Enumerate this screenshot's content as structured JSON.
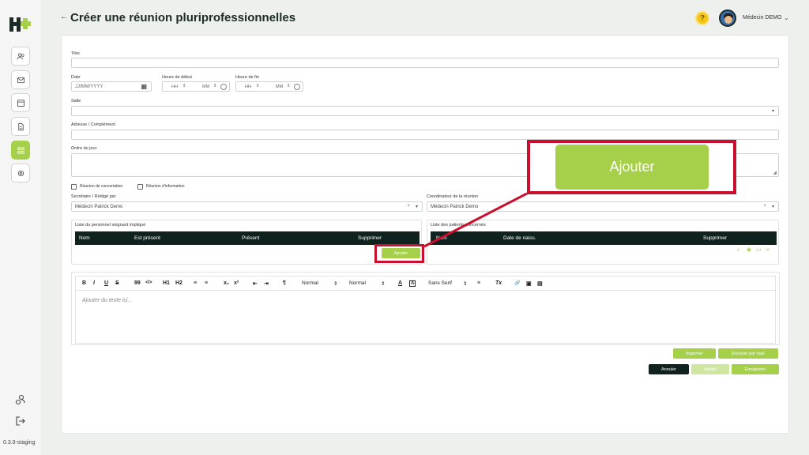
{
  "app": {
    "title": "Créer une réunion pluriprofessionnelles",
    "version": "0.3.9-staging",
    "user_name": "Médecin DEMO",
    "help_label": "?"
  },
  "sidebar": {
    "items": [
      {
        "icon": "users-icon"
      },
      {
        "icon": "mail-icon"
      },
      {
        "icon": "calendar-icon"
      },
      {
        "icon": "document-icon"
      },
      {
        "icon": "dashboard-icon",
        "active": true
      },
      {
        "icon": "settings-icon"
      }
    ],
    "bottom": [
      {
        "icon": "user-settings-icon"
      },
      {
        "icon": "logout-icon"
      }
    ]
  },
  "form": {
    "titre_label": "Titre",
    "date_label": "Date",
    "date_placeholder": "JJ/MM/YYYY",
    "heure_debut_label": "Heure de début",
    "heure_fin_label": "Heure de fin",
    "hh": "HH",
    "mm": "MM",
    "salle_label": "Salle",
    "adresse_label": "Adresse / Complément",
    "ordre_label": "Ordre du jour",
    "concertation_label": "Réunion de concertation",
    "information_label": "Réunion d'information",
    "secretaire_label": "Secrétaire / Rédigé par",
    "secretaire_value": "Médecin Patrick Demo",
    "coordinateur_label": "Coordinateur de la réunion",
    "coordinateur_value": "Médecin Patrick Demo",
    "clear_symbol": "×"
  },
  "personnel_table": {
    "title": "Liste du personnel soignant impliqué",
    "columns": [
      "Nom",
      "Est présent",
      "Présent",
      "Supprimer"
    ],
    "add_button": "Ajouter"
  },
  "patients_table": {
    "title": "Liste des patients concernés",
    "columns": [
      "Nom",
      "Date de naiss.",
      "Supprimer"
    ]
  },
  "editor": {
    "toolbar": [
      "B",
      "I",
      "U",
      "S",
      "99",
      "</>",
      "H1",
      "H2",
      "≡",
      "≡",
      "x₂",
      "x²",
      "⇤",
      "⇥",
      "¶",
      "Normal",
      "Normal",
      "A",
      "A",
      "Sans Serif",
      "≡",
      "Tx",
      "🔗",
      "▣",
      "▤"
    ],
    "placeholder": "Ajouter du texte ici..."
  },
  "actions": {
    "imprimer": "Imprimer",
    "envoyer": "Envoyer par mail",
    "annuler": "Annuler",
    "valider": "Valider",
    "enregistrer": "Enregistrer"
  },
  "callout": {
    "label": "Ajouter"
  },
  "colors": {
    "accent": "#a6d04a",
    "dark": "#0f221d",
    "highlight": "#c8102e"
  }
}
